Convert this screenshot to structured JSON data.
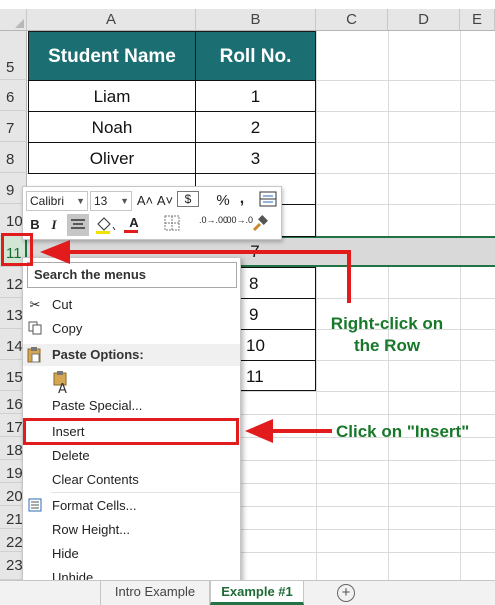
{
  "columns": [
    "A",
    "B",
    "C",
    "D",
    "E"
  ],
  "rows": [
    "5",
    "6",
    "7",
    "8",
    "9",
    "10",
    "11",
    "12",
    "13",
    "14",
    "15",
    "16",
    "17",
    "18",
    "19",
    "20",
    "21",
    "22",
    "23"
  ],
  "table": {
    "headers": [
      "Student Name",
      "Roll No."
    ],
    "rows": [
      [
        "Liam",
        "1"
      ],
      [
        "Noah",
        "2"
      ],
      [
        "Oliver",
        "3"
      ],
      [
        "",
        "7"
      ],
      [
        "",
        "8"
      ],
      [
        "",
        "9"
      ],
      [
        "",
        "10"
      ],
      [
        "",
        "11"
      ]
    ]
  },
  "mini_toolbar": {
    "font": "Calibri",
    "size": "13",
    "grow": "A˄",
    "shrink": "A˅",
    "currency": "$",
    "percent": "%",
    "comma": ",",
    "bold": "B",
    "italic": "I",
    "font_color": "A",
    "inc_decimal": ".0→.00",
    "dec_decimal": ".00→.0"
  },
  "context_menu": {
    "search": "Search the menus",
    "cut": "Cut",
    "copy": "Copy",
    "paste_options": "Paste Options:",
    "paste_special": "Paste Special...",
    "insert": "Insert",
    "delete": "Delete",
    "clear_contents": "Clear Contents",
    "format_cells": "Format Cells...",
    "row_height": "Row Height...",
    "hide": "Hide",
    "unhide": "Unhide"
  },
  "annotations": {
    "right_click": "Right-click on the Row",
    "click_insert": "Click on \"Insert\""
  },
  "sheet_tabs": {
    "tab1": "Intro Example",
    "tab2": "Example #1",
    "add": "+"
  },
  "colors": {
    "header_fill": "#1b6f73",
    "accent_green": "#217346",
    "annotation_red": "#e21c1c",
    "annotation_text": "#17782a"
  }
}
